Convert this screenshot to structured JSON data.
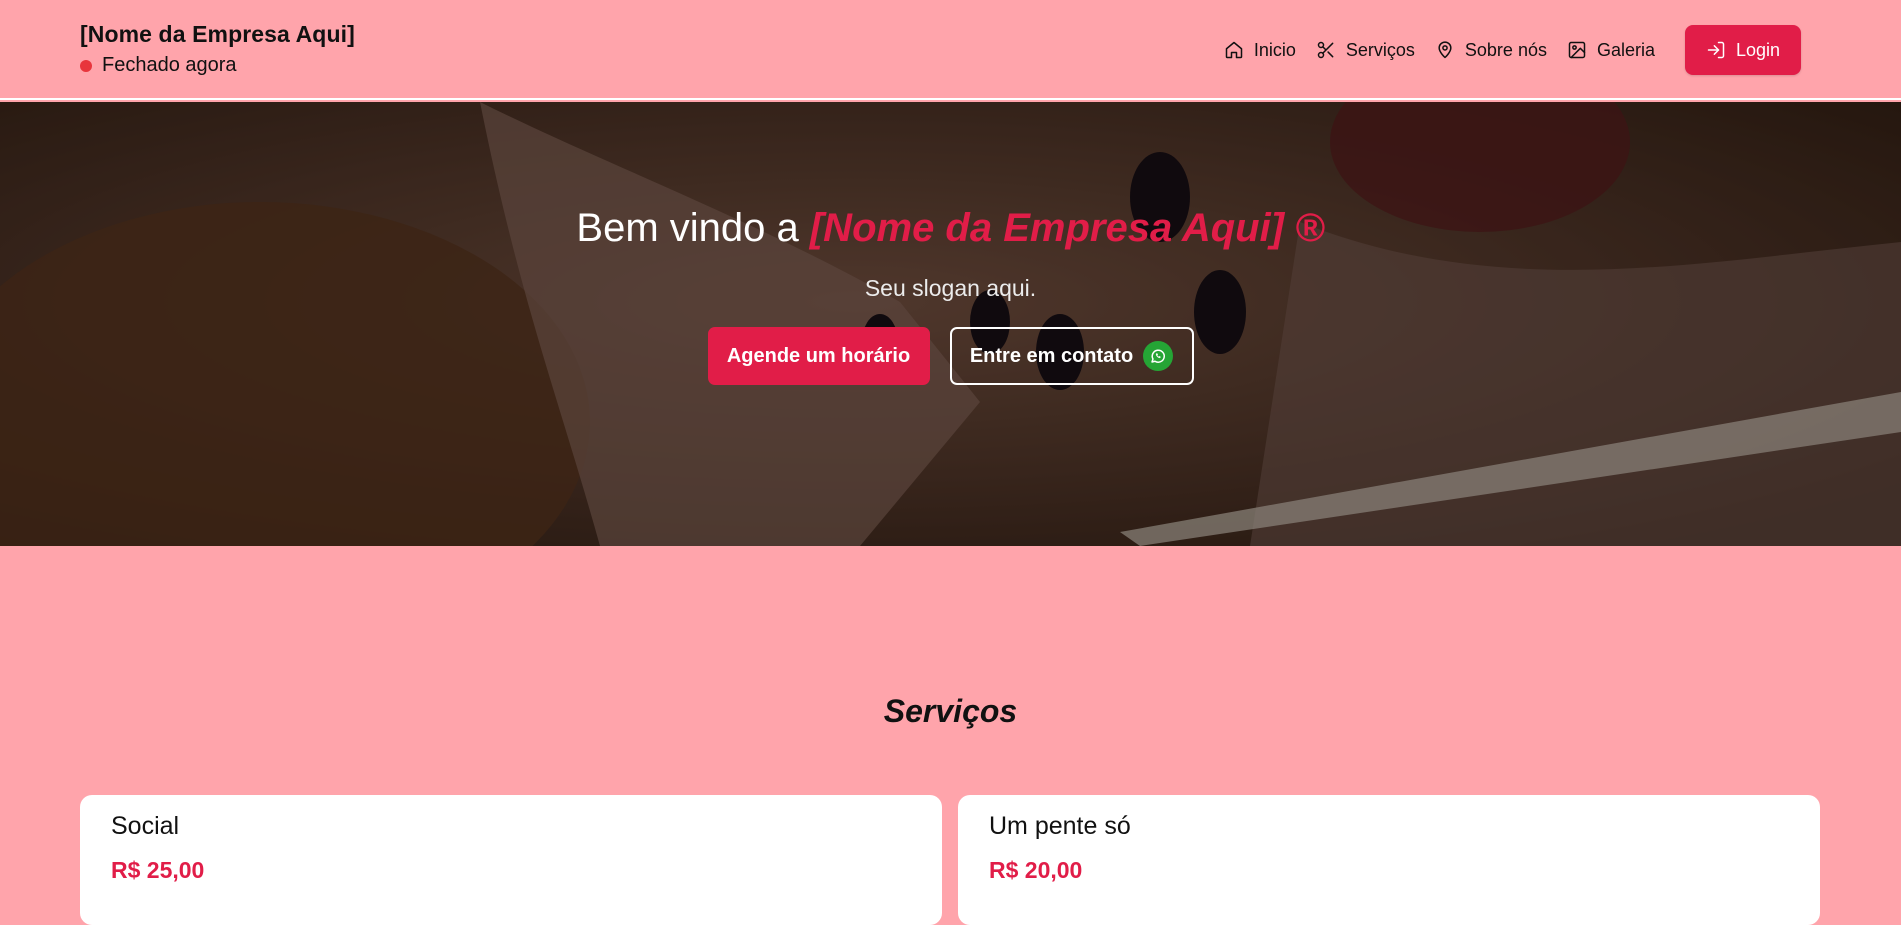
{
  "header": {
    "company_name": "[Nome da Empresa Aqui]",
    "status_text": "Fechado agora",
    "status_color": "#e8353c",
    "nav": [
      {
        "label": "Inicio",
        "icon": "home-icon"
      },
      {
        "label": "Serviços",
        "icon": "scissors-icon"
      },
      {
        "label": "Sobre nós",
        "icon": "map-pin-icon"
      },
      {
        "label": "Galeria",
        "icon": "image-icon"
      }
    ],
    "login_label": "Login"
  },
  "hero": {
    "title_prefix": "Bem vindo a",
    "title_company": "[Nome da Empresa Aqui] ®",
    "slogan": "Seu slogan aqui.",
    "primary_button": "Agende um horário",
    "secondary_button": "Entre em contato"
  },
  "services": {
    "title": "Serviços",
    "items": [
      {
        "name": "Social",
        "price": "R$ 25,00"
      },
      {
        "name": "Um pente só",
        "price": "R$ 20,00"
      }
    ]
  },
  "colors": {
    "background": "#ffa4ab",
    "accent": "#e11d48",
    "whatsapp": "#25a535"
  }
}
